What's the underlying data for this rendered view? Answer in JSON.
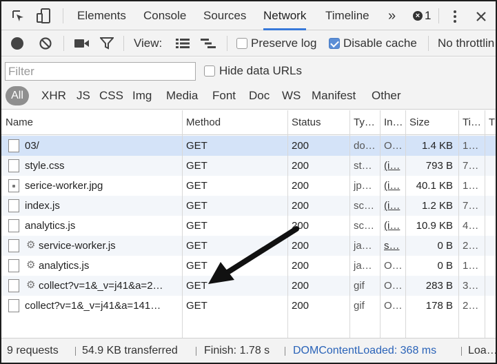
{
  "tabs": [
    {
      "label": "Elements",
      "active": false
    },
    {
      "label": "Console",
      "active": false
    },
    {
      "label": "Sources",
      "active": false
    },
    {
      "label": "Network",
      "active": true
    },
    {
      "label": "Timeline",
      "active": false
    }
  ],
  "overflow_label": "»",
  "errors": {
    "icon": "error-x-icon",
    "count": "1"
  },
  "toolbar": {
    "view_label": "View:",
    "preserve_log": {
      "label": "Preserve log",
      "checked": false
    },
    "disable_cache": {
      "label": "Disable cache",
      "checked": true
    },
    "throttling": "No throttlin"
  },
  "filter": {
    "placeholder": "Filter",
    "hide_data_urls": {
      "label": "Hide data URLs",
      "checked": false
    },
    "types": [
      "All",
      "XHR",
      "JS",
      "CSS",
      "Img",
      "Media",
      "Font",
      "Doc",
      "WS",
      "Manifest",
      "Other"
    ]
  },
  "table": {
    "columns": [
      "Name",
      "Method",
      "Status",
      "Ty…",
      "In…",
      "Size",
      "Ti…",
      "T"
    ],
    "rows": [
      {
        "name": "03/",
        "method": "GET",
        "status": "200",
        "type": "do…",
        "initiator": "O…",
        "size": "1.4 KB",
        "time": "1…",
        "icon": "doc",
        "gear": false,
        "initiator_link": false
      },
      {
        "name": "style.css",
        "method": "GET",
        "status": "200",
        "type": "st…",
        "initiator": "(i…",
        "size": "793 B",
        "time": "7…",
        "icon": "doc",
        "gear": false,
        "initiator_link": true
      },
      {
        "name": "serice-worker.jpg",
        "method": "GET",
        "status": "200",
        "type": "jp…",
        "initiator": "(i…",
        "size": "40.1 KB",
        "time": "1…",
        "icon": "img",
        "gear": false,
        "initiator_link": true
      },
      {
        "name": "index.js",
        "method": "GET",
        "status": "200",
        "type": "sc…",
        "initiator": "(i…",
        "size": "1.2 KB",
        "time": "7…",
        "icon": "doc",
        "gear": false,
        "initiator_link": true
      },
      {
        "name": "analytics.js",
        "method": "GET",
        "status": "200",
        "type": "sc…",
        "initiator": "(i…",
        "size": "10.9 KB",
        "time": "4…",
        "icon": "doc",
        "gear": false,
        "initiator_link": true
      },
      {
        "name": "service-worker.js",
        "method": "GET",
        "status": "200",
        "type": "ja…",
        "initiator": "s…",
        "size": "0 B",
        "time": "2…",
        "icon": "doc",
        "gear": true,
        "initiator_link": true
      },
      {
        "name": "analytics.js",
        "method": "GET",
        "status": "200",
        "type": "ja…",
        "initiator": "O…",
        "size": "0 B",
        "time": "1…",
        "icon": "doc",
        "gear": true,
        "initiator_link": false
      },
      {
        "name": "collect?v=1&_v=j41&a=2…",
        "method": "GET",
        "status": "200",
        "type": "gif",
        "initiator": "O…",
        "size": "283 B",
        "time": "3…",
        "icon": "doc",
        "gear": true,
        "initiator_link": false
      },
      {
        "name": "collect?v=1&_v=j41&a=141…",
        "method": "GET",
        "status": "200",
        "type": "gif",
        "initiator": "O…",
        "size": "178 B",
        "time": "2…",
        "icon": "doc",
        "gear": false,
        "initiator_link": false
      }
    ]
  },
  "status": {
    "requests": "9 requests",
    "transferred": "54.9 KB transferred",
    "finish": "Finish: 1.78 s",
    "dom_content_loaded": "DOMContentLoaded: 368 ms",
    "load": "Loa…"
  },
  "colors": {
    "accent": "#3879d9",
    "selected_row": "#d4e3f8",
    "dom_loaded": "#2a63b8"
  }
}
